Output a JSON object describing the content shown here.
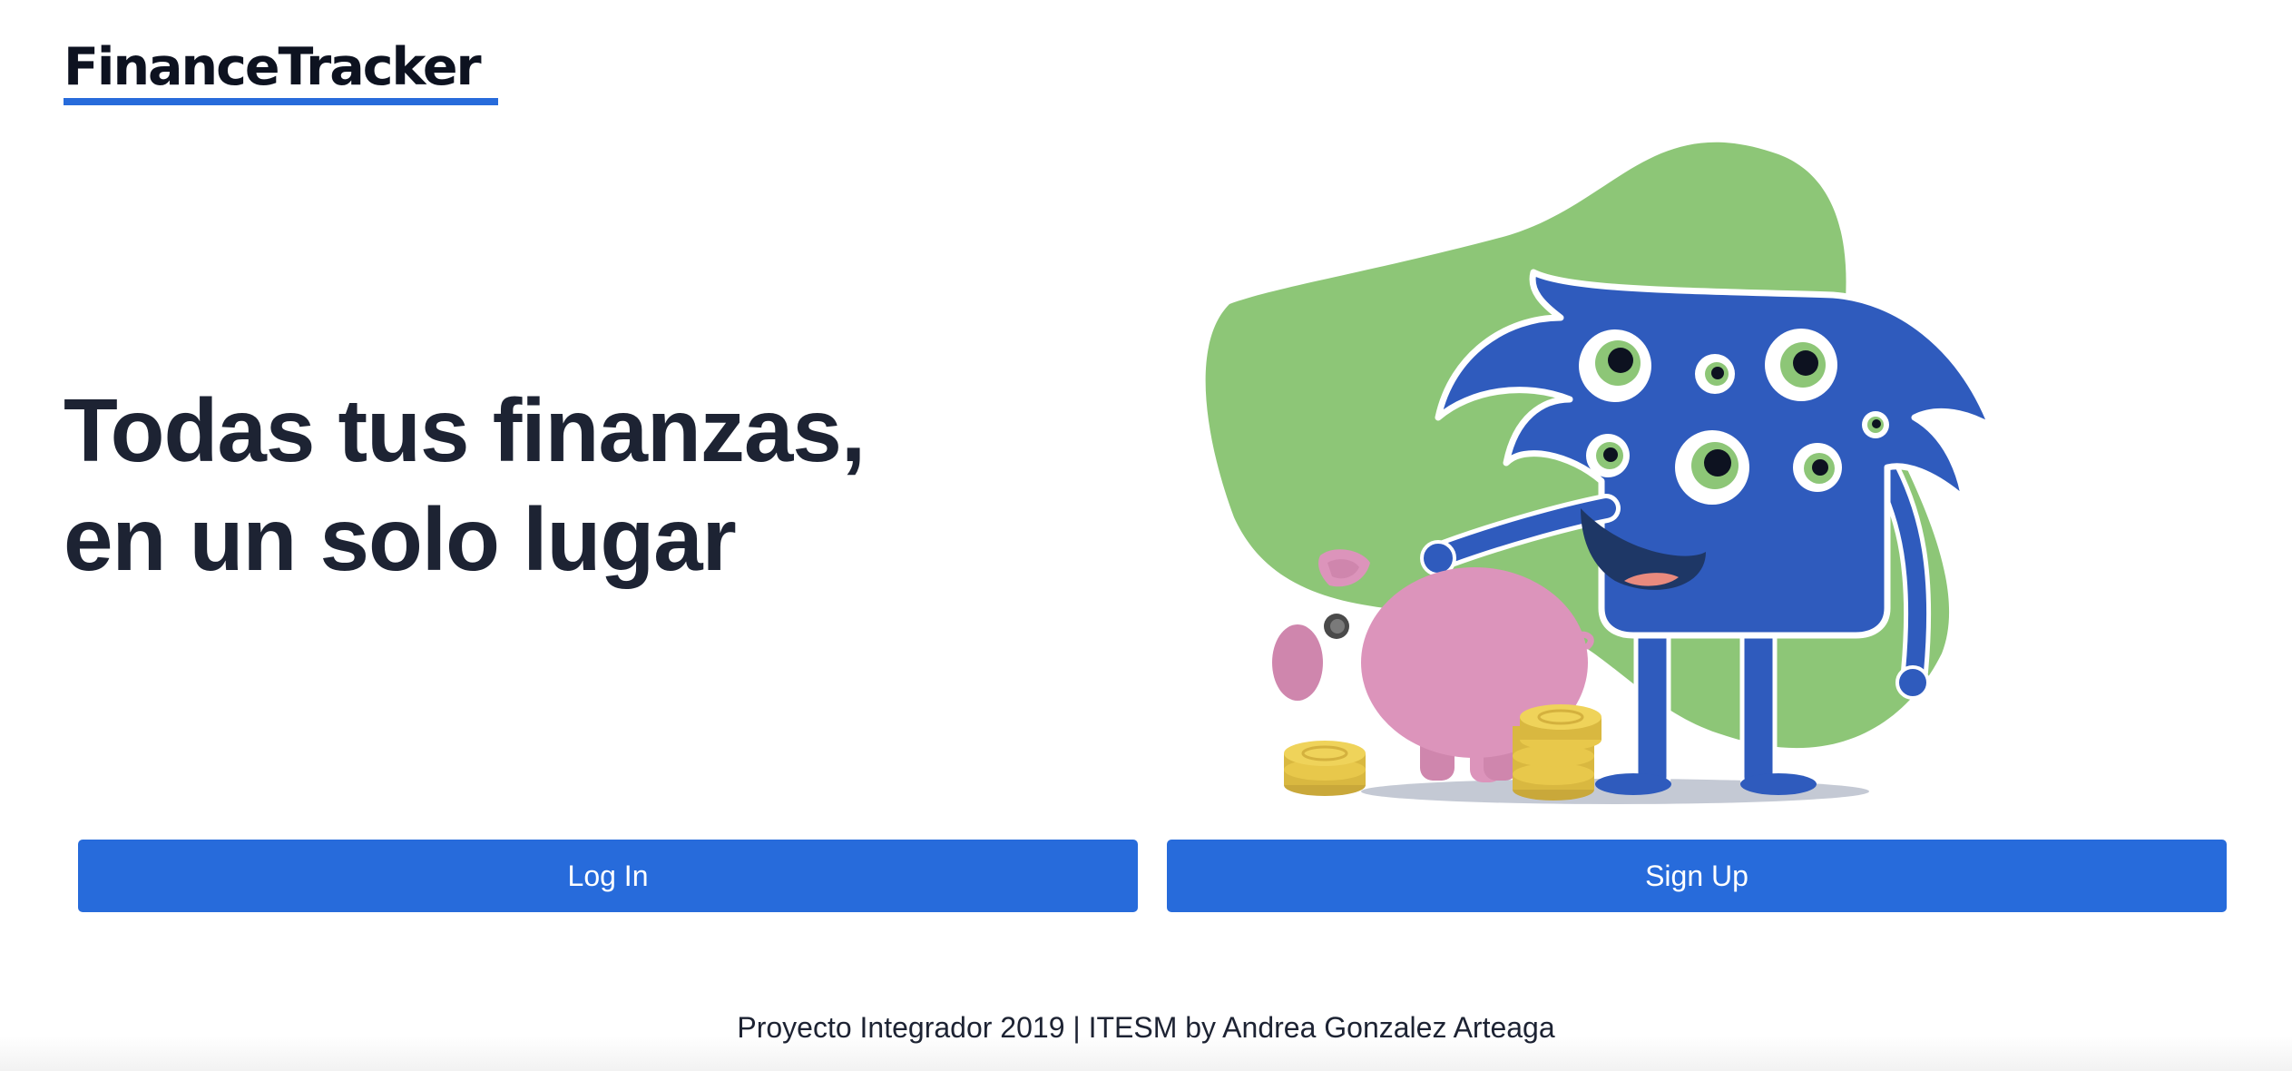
{
  "header": {
    "logo_text": "FinanceTracker",
    "accent_color": "#276bdb"
  },
  "hero": {
    "headline_line1": "Todas tus finanzas,",
    "headline_line2": "en un solo lugar",
    "illustration_icons": [
      "blob-background",
      "blue-monster-icon",
      "piggy-bank-icon",
      "coin-stack-icon"
    ]
  },
  "actions": {
    "login_label": "Log In",
    "signup_label": "Sign Up",
    "button_color": "#276bdb"
  },
  "footer": {
    "text": "Proyecto Integrador 2019 | ITESM by Andrea Gonzalez Arteaga"
  }
}
